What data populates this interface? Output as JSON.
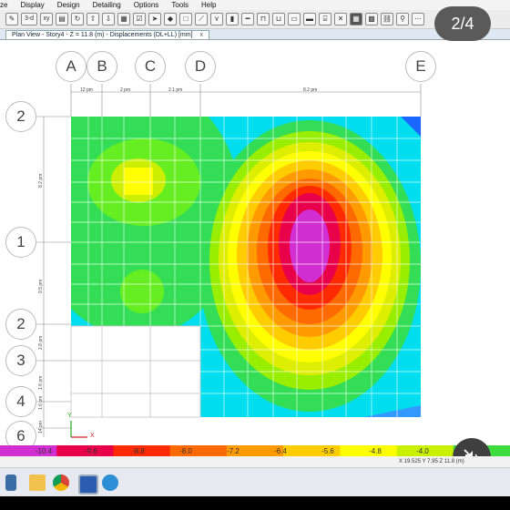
{
  "menubar": {
    "items": [
      "ze",
      "Display",
      "Design",
      "Detailing",
      "Options",
      "Tools",
      "Help"
    ]
  },
  "toolbar": {
    "view_3d_label": "3-d",
    "view_xy_label": "xy"
  },
  "tab": {
    "title": "Plan View - Story4 - Z = 11.8 (m)   - Displacements (DL+LL)  [mm]",
    "close": "x"
  },
  "grid": {
    "columns": [
      "A",
      "B",
      "C",
      "D",
      "E"
    ],
    "rows": [
      "2",
      "1",
      "2",
      "3",
      "4",
      "6"
    ],
    "col_spacing": [
      "12 pm",
      "2 pm",
      "2.1 pm",
      "8.2 pm"
    ],
    "row_spacing": [
      "8.2 pm",
      "9.5 pm",
      "2.8 pm",
      "1.6 pm",
      "1.6 pm",
      "14 pm"
    ]
  },
  "axis": {
    "y": "Y",
    "x": "X"
  },
  "legend": {
    "ticks": [
      "-10.4",
      "-9.6",
      "-8.8",
      "-8.0",
      "-7.2",
      "-6.4",
      "-5.6",
      "-4.8",
      "-4.0"
    ],
    "colors": [
      "#d22fd2",
      "#e8004a",
      "#ff2a00",
      "#ff6a00",
      "#ff9a00",
      "#ffcc00",
      "#ffff00",
      "#c8f000",
      "#3edb3e"
    ]
  },
  "status": {
    "coords": "X 19.525  Y 7.95  Z 11.8 (m)"
  },
  "pager": {
    "label": "2/4"
  },
  "taskbar": {
    "apps": [
      "file-explorer",
      "folder",
      "chrome-browser",
      "etabs-app",
      "safe-app"
    ]
  }
}
